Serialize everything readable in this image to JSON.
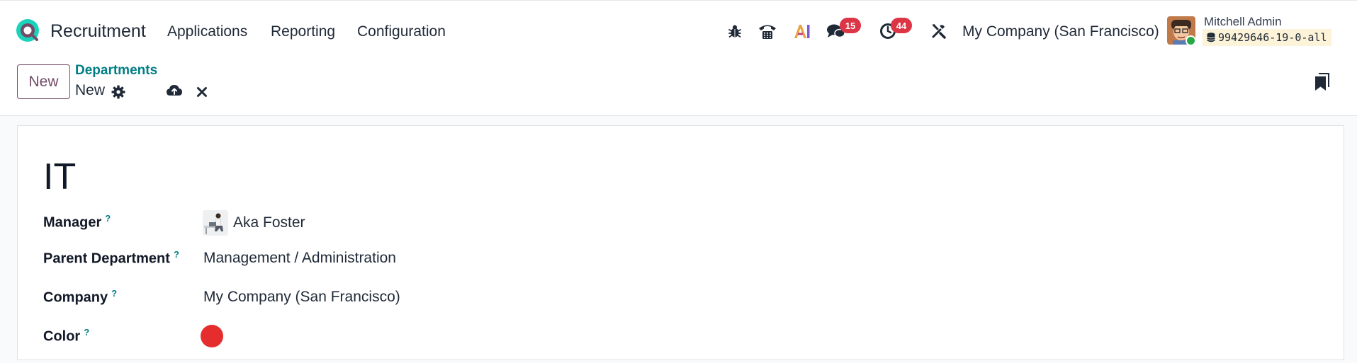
{
  "app": {
    "name": "Recruitment",
    "logo_icon": "recruitment-logo-icon"
  },
  "menu": [
    {
      "label": "Applications"
    },
    {
      "label": "Reporting"
    },
    {
      "label": "Configuration"
    }
  ],
  "systray": {
    "icons": [
      "bug-icon",
      "phone-icon",
      "ai-icon",
      "chat-icon",
      "clock-icon",
      "tools-icon"
    ],
    "messages_count": "15",
    "activities_count": "44",
    "company": "My Company (San Francisco)",
    "user_name": "Mitchell Admin",
    "database": "99429646-19-0-all"
  },
  "control": {
    "new_label": "New",
    "breadcrumb_parent": "Departments",
    "record_name": "New"
  },
  "form": {
    "title": "IT",
    "fields": {
      "manager": {
        "label": "Manager",
        "help": "?",
        "value": "Aka Foster"
      },
      "parent_department": {
        "label": "Parent Department",
        "help": "?",
        "value": "Management / Administration"
      },
      "company": {
        "label": "Company",
        "help": "?",
        "value": "My Company (San Francisco)"
      },
      "color": {
        "label": "Color",
        "help": "?",
        "value": "#e62d2d"
      }
    }
  },
  "colors": {
    "brand": "#714b67",
    "link": "#017e84",
    "badge": "#dc3545",
    "online": "#28a745"
  }
}
